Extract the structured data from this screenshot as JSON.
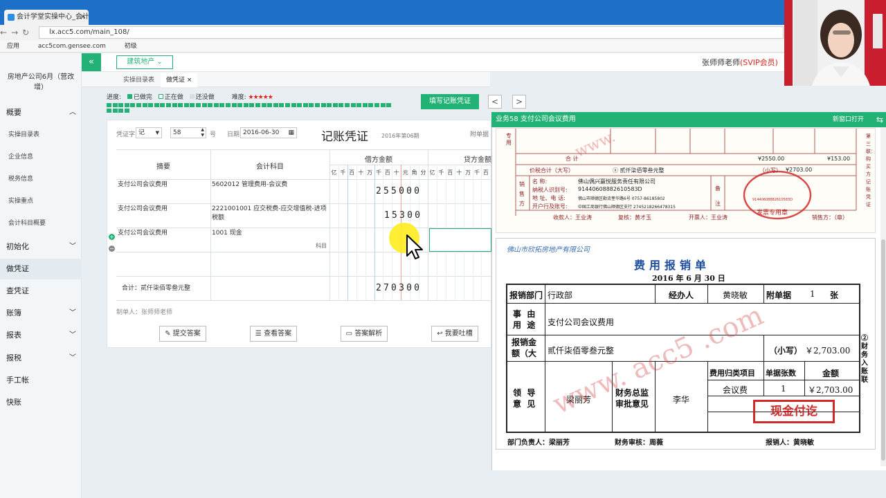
{
  "browser": {
    "tab_title": "会计学堂实操中心_会计实",
    "url": "lx.acc5.com/main_108/",
    "bookmarks": [
      "应用",
      "acc5com.gensee.com",
      "初级"
    ]
  },
  "app": {
    "industry_label": "建筑地产",
    "user_name": "张师师老师",
    "user_level": "(SVIP会员)",
    "company": "房地产公司6月（营改增）"
  },
  "sidebar": {
    "items": [
      {
        "label": "概要",
        "type": "main",
        "chevron": "up"
      },
      {
        "label": "实操目录表",
        "type": "sub"
      },
      {
        "label": "企业信息",
        "type": "sub"
      },
      {
        "label": "税务信息",
        "type": "sub"
      },
      {
        "label": "实操重点",
        "type": "sub"
      },
      {
        "label": "会计科目概要",
        "type": "sub"
      },
      {
        "label": "初始化",
        "type": "main",
        "chevron": "down"
      },
      {
        "label": "做凭证",
        "type": "main",
        "active": true
      },
      {
        "label": "查凭证",
        "type": "main"
      },
      {
        "label": "账簿",
        "type": "main",
        "chevron": "down"
      },
      {
        "label": "报表",
        "type": "main",
        "chevron": "down"
      },
      {
        "label": "报税",
        "type": "main",
        "chevron": "down"
      },
      {
        "label": "手工帐",
        "type": "main"
      },
      {
        "label": "快账",
        "type": "main"
      }
    ]
  },
  "tabs": [
    {
      "label": "实操目录表"
    },
    {
      "label": "做凭证",
      "close": "×"
    }
  ],
  "progress": {
    "label": "进度:",
    "done": "已做完",
    "doing": "正在做",
    "todo": "还没做",
    "difficulty_label": "难度:",
    "stars": "★★★★★",
    "colors": {
      "done": "#23b275",
      "doing": "#ffffff",
      "todo": "#d8dde1"
    }
  },
  "toolbar": {
    "fill_button": "填写记账凭证",
    "prev": "<",
    "next": ">"
  },
  "voucher": {
    "word_label": "凭证字",
    "word_value": "记",
    "number_value": "58",
    "number_unit": "号",
    "date_label": "日期",
    "date_value": "2016-06-30",
    "title": "记账凭证",
    "period": "2016年第06期",
    "attach_label": "附单据",
    "col_summary": "摘要",
    "col_account": "会计科目",
    "col_debit": "借方金额",
    "col_credit": "贷方金额",
    "digit_headers": [
      "亿",
      "千",
      "百",
      "十",
      "万",
      "千",
      "百",
      "十",
      "元",
      "角",
      "分"
    ],
    "credit_digit_headers": [
      "亿",
      "千",
      "百",
      "十",
      "万",
      "千",
      "百"
    ],
    "rows": [
      {
        "summary": "支付公司会议费用",
        "account": "5602012 管理费用-会议费",
        "debit": "255000",
        "credit": ""
      },
      {
        "summary": "支付公司会议费用",
        "account": "2221001001 应交税费-应交增值税-进项税额",
        "debit": "15300",
        "credit": ""
      },
      {
        "summary": "支付公司会议费用",
        "account": "1001 现金",
        "debit": "",
        "credit": "",
        "hint": "科目"
      },
      {
        "summary": "",
        "account": "",
        "debit": "",
        "credit": ""
      }
    ],
    "total_label": "合计：贰仟柒佰零叁元整",
    "total_debit": "270300",
    "maker": "制单人：张师师老师"
  },
  "actions": [
    {
      "label": "提交答案",
      "icon": "edit-icon",
      "glyph": "✎"
    },
    {
      "label": "查看答案",
      "icon": "database-icon",
      "glyph": "☰"
    },
    {
      "label": "答案解析",
      "icon": "folder-icon",
      "glyph": "▭"
    },
    {
      "label": "我要吐槽",
      "icon": "reply-icon",
      "glyph": "↩"
    }
  ],
  "panel": {
    "title": "业务58 支付公司会议费用",
    "new_window": "新窗口打开",
    "switch_icon": "⇆"
  },
  "invoice": {
    "side_left": "专用",
    "heji": "合    计",
    "amount1": "¥2550.00",
    "amount2": "¥153.00",
    "jiashui_label": "价税合计（大写）",
    "jiashui_cn": "ⓧ 贰仟柒佰零叁元整",
    "small_label": "（小写）",
    "jiashui_num": "¥2703.00",
    "seller_label": "销售方",
    "seller_name": "佛山偶兴赢悦服务责任有限公司",
    "seller_tax": "91440608882610583D",
    "seller_addr": "佛山市顺德区勒流奎华路6号 0757-86185802",
    "seller_bank": "中国工商银行佛山顺德区支行 2745218266478315",
    "field_labels": [
      "名     称:",
      "纳税人识别号:",
      "地 址、电 话:",
      "开户行及账号:"
    ],
    "remark_label": "备注",
    "payee": "收款人：王业涛",
    "reviewer": "复核：黄才玉",
    "issuer": "开票人：王业涛",
    "seller_mark": "销售方：（章）",
    "stamp_text": "发票专用章",
    "stamp_num": "91440608882610583D",
    "side_right": "第三联：购买方记账凭证",
    "watermark": "www."
  },
  "reimbursement": {
    "company": "佛山市欣拓房地产有限公司",
    "title": "费用报销单",
    "date": "2016 年 6 月 30 日",
    "dept_label": "报销部门",
    "dept_value": "行政部",
    "handler_label": "经办人",
    "handler_value": "黄晓敏",
    "attach_label": "附单据",
    "attach_value": "1",
    "attach_unit": "张",
    "reason_label": "事  由\n用  途",
    "reason_value": "支付公司会议费用",
    "amount_label": "报销金\n额（大",
    "amount_cn": "贰仟柒佰零叁元整",
    "small_label": "（小写）",
    "amount_num": "￥2,703.00",
    "side_note": "②财务入账联",
    "leader_label": "领  导\n意  见",
    "leader_value": "梁丽芳",
    "finance_label": "财务总监\n审批意见",
    "finance_value": "李华",
    "cat_header": "费用归类项目",
    "count_header": "单据张数",
    "amt_header": "金额",
    "cat_value": "会议费",
    "count_value": "1",
    "amt_value": "￥2,703.00",
    "stamp": "现金付讫",
    "dept_head": "部门负责人：梁丽芳",
    "fin_review": "财务审核：周薇",
    "reimburser": "报销人：黄晓敏",
    "watermark": "www. acc5 .com"
  }
}
